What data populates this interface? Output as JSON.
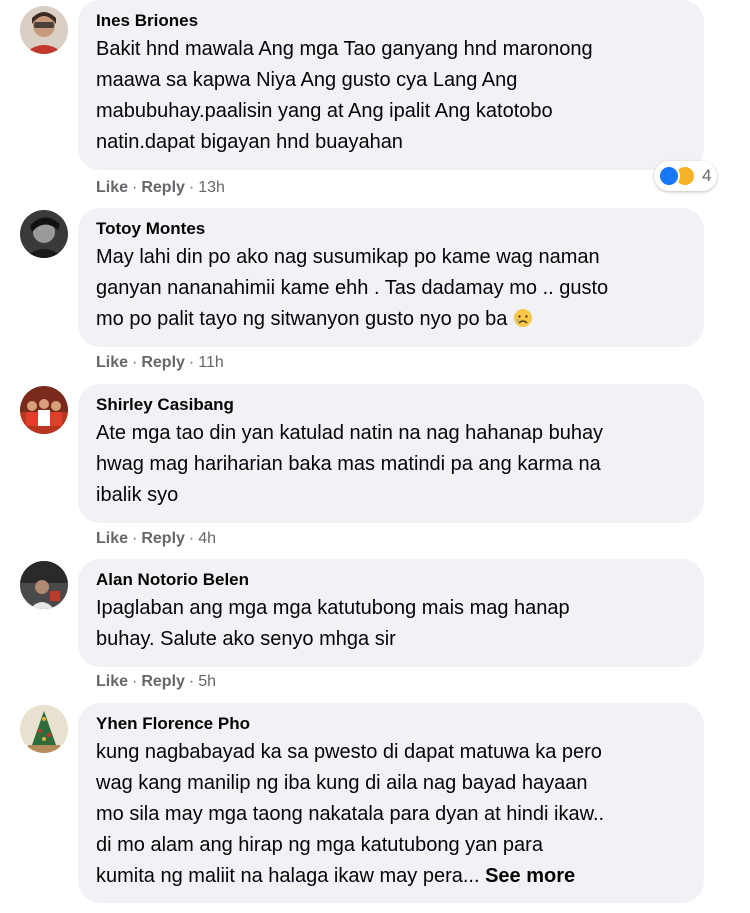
{
  "comments": [
    {
      "author": "Ines Briones",
      "text": "Bakit hnd mawala Ang mga Tao ganyang hnd maronong\nmaawa sa kapwa Niya Ang gusto cya Lang Ang\nmabubuhay.paalisin yang at Ang ipalit Ang katotobo\nnatin.dapat bigayan hnd buayahan",
      "like_label": "Like",
      "reply_label": "Reply",
      "time": "13h",
      "reaction_count": "4",
      "avatar_icon": "profile-photo"
    },
    {
      "author": "Totoy Montes",
      "text": "May lahi din po ako nag susumikap po kame wag naman\nganyan nananahimii kame ehh . Tas dadamay mo .. gusto\nmo po palit tayo ng sitwanyon gusto nyo po ba",
      "emoji": "crying-face-emoji",
      "like_label": "Like",
      "reply_label": "Reply",
      "time": "11h",
      "avatar_icon": "profile-photo"
    },
    {
      "author": "Shirley Casibang",
      "text": "Ate mga tao din yan katulad natin na nag hahanap buhay\nhwag mag hariharian baka mas matindi pa ang karma na\nibalik syo",
      "like_label": "Like",
      "reply_label": "Reply",
      "time": "4h",
      "avatar_icon": "profile-photo"
    },
    {
      "author": "Alan Notorio Belen",
      "text": "Ipaglaban ang mga mga katutubong mais mag hanap\nbuhay. Salute ako senyo mhga sir",
      "like_label": "Like",
      "reply_label": "Reply",
      "time": "5h",
      "avatar_icon": "profile-photo"
    },
    {
      "author": "Yhen Florence Pho",
      "text": "kung nagbabayad ka sa pwesto di dapat matuwa ka pero\nwag kang manilip ng iba kung di aila nag bayad hayaan\nmo sila may mga taong nakatala para dyan at hindi ikaw..\ndi mo alam ang hirap ng mga katutubong yan para\nkumita ng maliit na halaga ikaw may pera...",
      "see_more": "See more",
      "avatar_icon": "profile-photo"
    }
  ],
  "colors": {
    "bubble": "#f0f2f5",
    "meta_text": "#65676b",
    "like_reaction": "#1877f2",
    "haha_reaction": "#f7b125"
  }
}
